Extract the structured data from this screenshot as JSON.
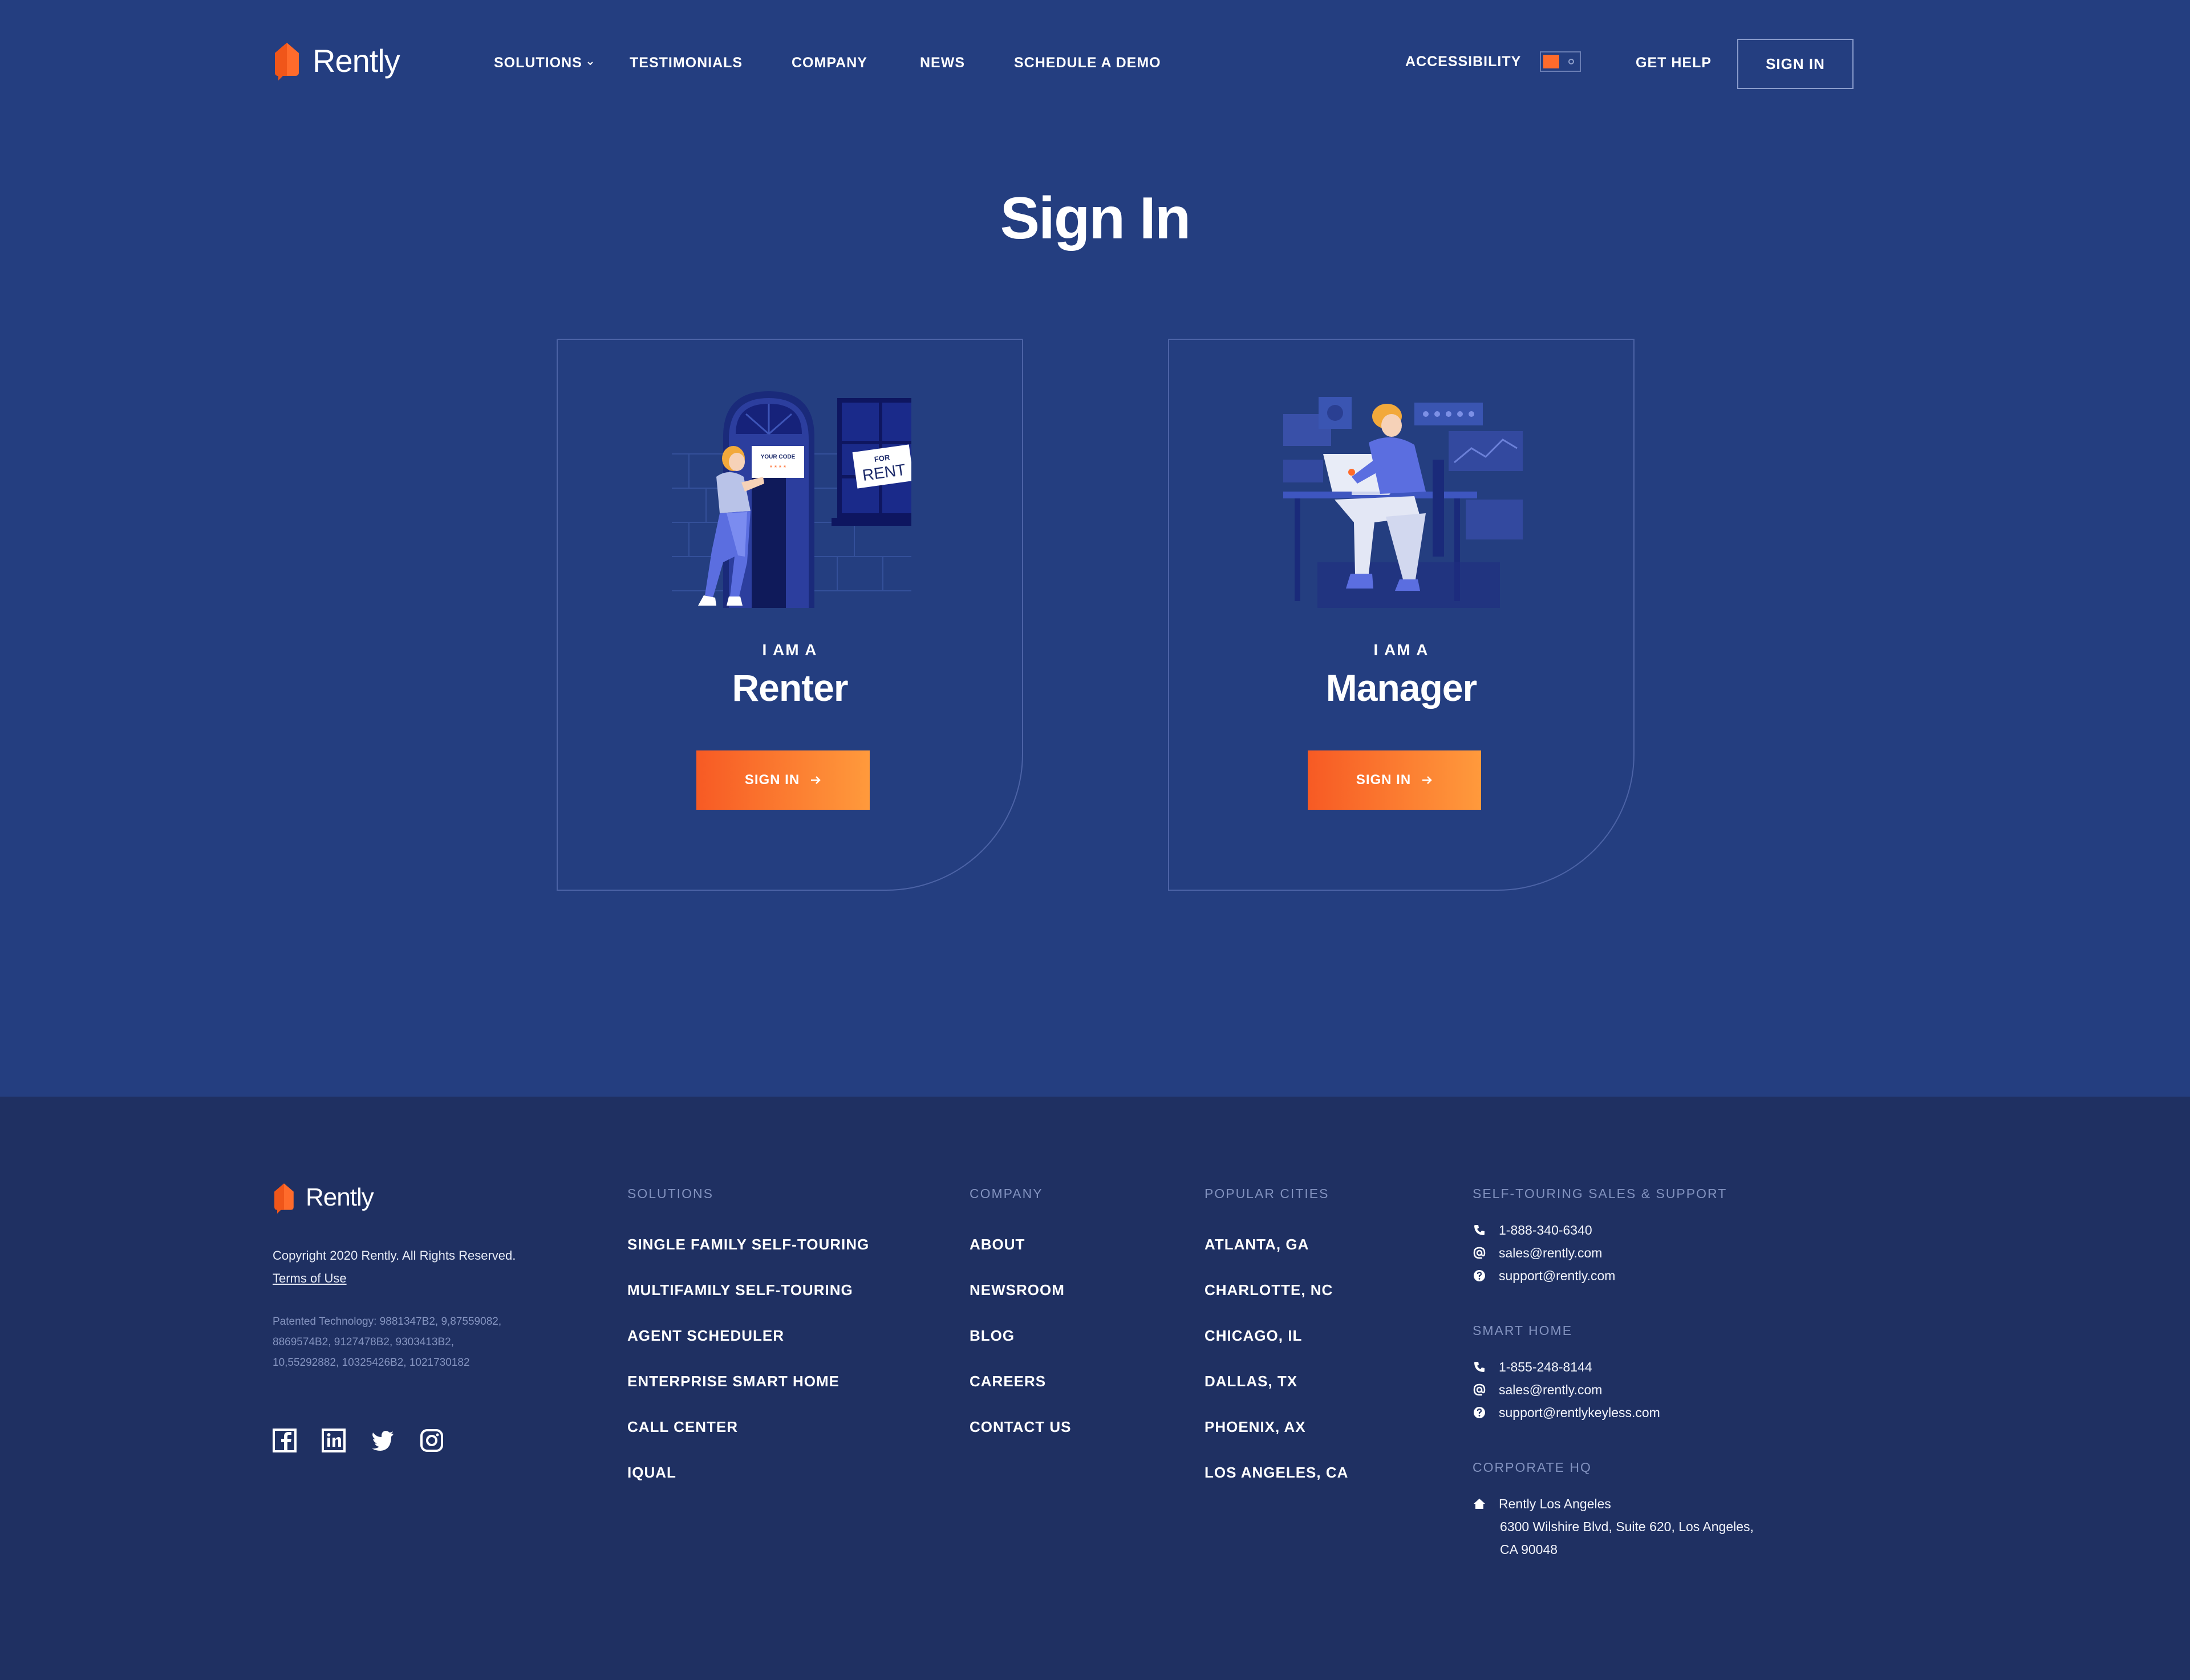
{
  "brand": {
    "name": "Rently",
    "accent": "#ff6b2b",
    "bg": "#243e80",
    "footer_bg": "#1f3062"
  },
  "nav": {
    "items": [
      "SOLUTIONS",
      "TESTIMONIALS",
      "COMPANY",
      "NEWS",
      "SCHEDULE A DEMO"
    ],
    "accessibility_label": "ACCESSIBILITY",
    "get_help": "GET HELP",
    "sign_in": "SIGN IN"
  },
  "main": {
    "title": "Sign In",
    "cards": [
      {
        "kicker": "I AM A",
        "role": "Renter",
        "button": "SIGN IN",
        "illus_code": "YOUR CODE",
        "illus_stars": "* * * *",
        "illus_sign_top": "FOR",
        "illus_sign_bottom": "RENT"
      },
      {
        "kicker": "I AM A",
        "role": "Manager",
        "button": "SIGN IN"
      }
    ]
  },
  "footer": {
    "copyright": "Copyright 2020 Rently. All Rights Reserved.",
    "terms": "Terms of Use",
    "patents": "Patented Technology: 9881347B2, 9,87559082, 8869574B2, 9127478B2, 9303413B2, 10,55292882, 10325426B2, 1021730182",
    "social": [
      "facebook-icon",
      "linkedin-icon",
      "twitter-icon",
      "instagram-icon"
    ],
    "solutions": {
      "heading": "SOLUTIONS",
      "links": [
        "SINGLE FAMILY SELF-TOURING",
        "MULTIFAMILY SELF-TOURING",
        "AGENT SCHEDULER",
        "ENTERPRISE SMART HOME",
        "CALL CENTER",
        "IQUAL"
      ]
    },
    "company": {
      "heading": "COMPANY",
      "links": [
        "ABOUT",
        "NEWSROOM",
        "BLOG",
        "CAREERS",
        "CONTACT US"
      ]
    },
    "cities": {
      "heading": "POPULAR CITIES",
      "links": [
        "ATLANTA, GA",
        "CHARLOTTE, NC",
        "CHICAGO, IL",
        "DALLAS, TX",
        "PHOENIX, AX",
        "LOS ANGELES, CA"
      ]
    },
    "self_touring": {
      "heading": "SELF-TOURING SALES & SUPPORT",
      "phone": "1-888-340-6340",
      "sales": "sales@rently.com",
      "support": "support@rently.com"
    },
    "smart_home": {
      "heading": "SMART HOME",
      "phone": "1-855-248-8144",
      "sales": "sales@rently.com",
      "support": "support@rentlykeyless.com"
    },
    "hq": {
      "heading": "CORPORATE HQ",
      "name": "Rently Los Angeles",
      "line1": "6300 Wilshire Blvd, Suite 620, Los Angeles,",
      "line2": "CA 90048"
    }
  }
}
